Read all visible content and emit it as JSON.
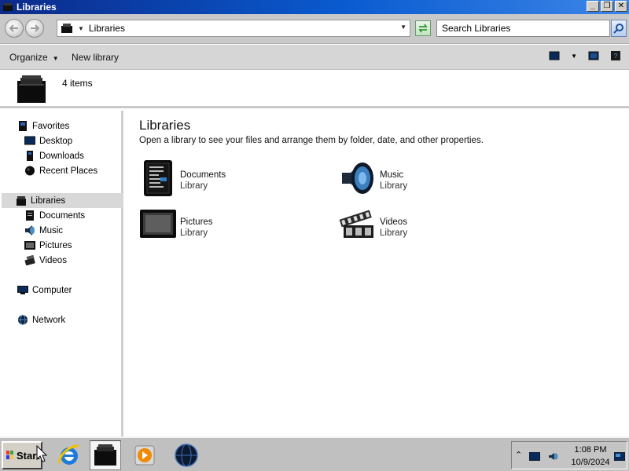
{
  "window": {
    "title": "Libraries"
  },
  "window_controls": {
    "minimize": "_",
    "maximize": "❐",
    "close": "✕"
  },
  "address_bar": {
    "crumb": "Libraries"
  },
  "search": {
    "placeholder": "Search Libraries"
  },
  "toolbar": {
    "organize": "Organize",
    "new_library": "New library"
  },
  "details": {
    "item_count": "4 items"
  },
  "nav": {
    "favorites": {
      "label": "Favorites",
      "items": [
        {
          "label": "Desktop",
          "icon": "desktop-icon"
        },
        {
          "label": "Downloads",
          "icon": "downloads-icon"
        },
        {
          "label": "Recent Places",
          "icon": "recent-places-icon"
        }
      ]
    },
    "libraries": {
      "label": "Libraries",
      "items": [
        {
          "label": "Documents",
          "icon": "documents-icon"
        },
        {
          "label": "Music",
          "icon": "music-icon"
        },
        {
          "label": "Pictures",
          "icon": "pictures-icon"
        },
        {
          "label": "Videos",
          "icon": "videos-icon"
        }
      ]
    },
    "computer": "Computer",
    "network": "Network"
  },
  "main": {
    "heading": "Libraries",
    "subtitle": "Open a library to see your files and arrange them by folder, date, and other properties.",
    "libraries": [
      {
        "name": "Documents",
        "type": "Library",
        "icon": "documents-library-icon"
      },
      {
        "name": "Music",
        "type": "Library",
        "icon": "music-library-icon"
      },
      {
        "name": "Pictures",
        "type": "Library",
        "icon": "pictures-library-icon"
      },
      {
        "name": "Videos",
        "type": "Library",
        "icon": "videos-library-icon"
      }
    ]
  },
  "taskbar": {
    "start_label": "Start",
    "clock_time": "1:08 PM",
    "clock_date": "10/9/2024"
  },
  "colors": {
    "titlebar": "#0a5bd0",
    "selection": "#d8d8d8",
    "chrome": "#c9c9c9"
  }
}
